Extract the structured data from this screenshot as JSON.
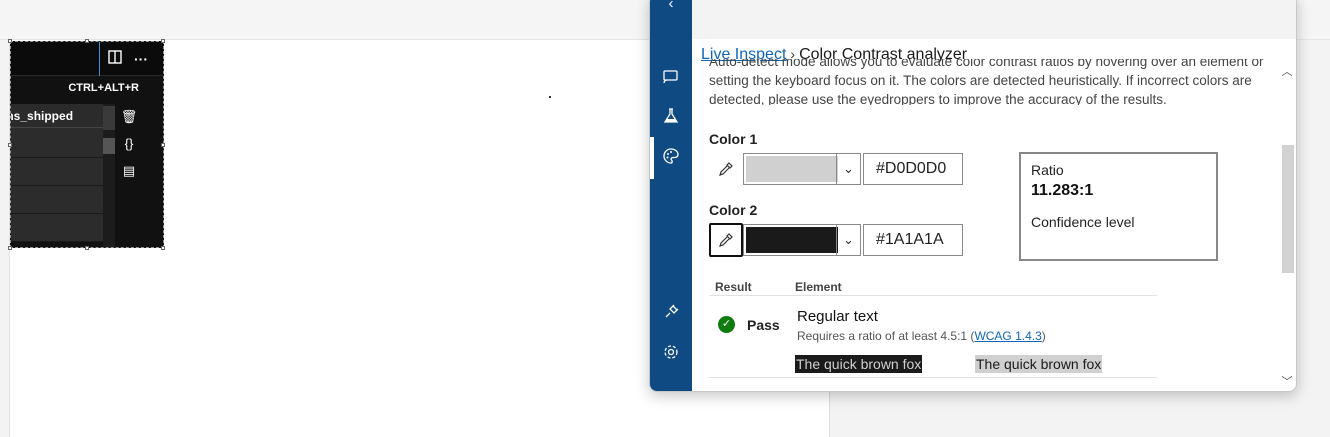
{
  "visual": {
    "shortcut_label": "CTRL+ALT+R",
    "column_header": "ms_shipped"
  },
  "breadcrumb": {
    "link_label": "Live Inspect",
    "current_label": "Color Contrast analyzer"
  },
  "description": "Auto-detect mode allows you to evaluate color contrast ratios by hovering over an element or setting the keyboard focus on it. The colors are detected heuristically. If incorrect colors are detected, please use the eyedroppers to improve the accuracy of the results.",
  "color1": {
    "label": "Color 1",
    "hex": "#D0D0D0",
    "swatch": "#D0D0D0"
  },
  "color2": {
    "label": "Color 2",
    "hex": "#1A1A1A",
    "swatch": "#1A1A1A"
  },
  "ratio": {
    "label": "Ratio",
    "value": "11.283:1",
    "confidence_label": "Confidence level"
  },
  "results": {
    "header_result": "Result",
    "header_element": "Element",
    "rows": [
      {
        "status": "Pass",
        "title": "Regular text",
        "requirement": "Requires a ratio of at least 4.5:1 (",
        "link_label": "WCAG 1.4.3",
        "requirement_end": ")",
        "sample_dark": "The quick brown fox",
        "sample_light": "The quick brown fox"
      }
    ]
  },
  "icons": {
    "rail": [
      "cast-icon",
      "flask-icon",
      "palette-icon",
      "plug-icon",
      "gear-icon"
    ],
    "eyedropper": "eyedropper-icon",
    "dropdown": "chevron-down-icon"
  },
  "colors": {
    "rail": "#0f4a83",
    "link": "#0f66b8",
    "pass": "#107c10"
  }
}
